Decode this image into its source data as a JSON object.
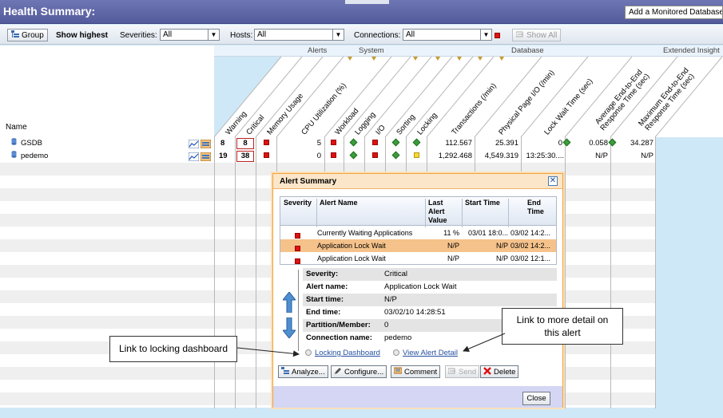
{
  "header": {
    "title": "Health Summary:",
    "add_button": "Add a Monitored Database..."
  },
  "toolbar": {
    "group_label": "Group",
    "show_highest_label": "Show highest",
    "severities_label": "Severities:",
    "severities_value": "All",
    "hosts_label": "Hosts:",
    "hosts_value": "All",
    "connections_label": "Connections:",
    "connections_value": "All",
    "show_all_label": "Show All"
  },
  "grid": {
    "groups": [
      "Alerts",
      "System",
      "Database",
      "Extended Insight"
    ],
    "name_header": "Name",
    "columns": [
      "Warning",
      "Critical",
      "Memory Usage",
      "CPU Utilization (%)",
      "Workload",
      "Logging",
      "I/O",
      "Sorting",
      "Locking",
      "Transactions (/min)",
      "Physical Page I/O (/min)",
      "Lock Wait Time (sec)",
      "Average End-to-End Response Time (sec)",
      "Maximum End-to-End Response Time (sec)"
    ],
    "rows": [
      {
        "name": "GSDB",
        "warning": "8",
        "critical": "8",
        "cpu": "5",
        "transactions": "112.567",
        "physical_io": "25.391",
        "lock_wait": "0",
        "avg_resp": "0.058",
        "max_resp": "34.287"
      },
      {
        "name": "pedemo",
        "warning": "19",
        "critical": "38",
        "cpu": "0",
        "transactions": "1,292.468",
        "physical_io": "4,549.319",
        "lock_wait": "13:25:30....",
        "avg_resp": "N/P",
        "max_resp": "N/P"
      }
    ]
  },
  "dialog": {
    "title": "Alert Summary",
    "table_headers": [
      "Severity",
      "Alert Name",
      "Last Alert Value",
      "Start Time",
      "End Time"
    ],
    "alerts": [
      {
        "name": "Currently Waiting Applications",
        "last": "11 %",
        "start": "03/01 18:0...",
        "end": "03/02 14:2..."
      },
      {
        "name": "Application Lock Wait",
        "last": "N/P",
        "start": "N/P",
        "end": "03/02 14:2..."
      },
      {
        "name": "Application Lock Wait",
        "last": "N/P",
        "start": "N/P",
        "end": "03/02 12:1..."
      }
    ],
    "details": [
      {
        "key": "Severity:",
        "value": "Critical"
      },
      {
        "key": "Alert name:",
        "value": "Application Lock Wait"
      },
      {
        "key": "Start time:",
        "value": "N/P"
      },
      {
        "key": "End time:",
        "value": "03/02/10 14:28:51"
      },
      {
        "key": "Partition/Member:",
        "value": "0"
      },
      {
        "key": "Connection name:",
        "value": "pedemo"
      }
    ],
    "locking_link": "Locking Dashboard",
    "detail_link": "View Alert Detail",
    "buttons": {
      "analyze": "Analyze...",
      "configure": "Configure...",
      "comment": "Comment",
      "send": "Send",
      "delete": "Delete",
      "close": "Close"
    }
  },
  "callouts": {
    "locking": "Link to locking dashboard",
    "detail_line1": "Link to more detail on",
    "detail_line2": "this alert"
  }
}
